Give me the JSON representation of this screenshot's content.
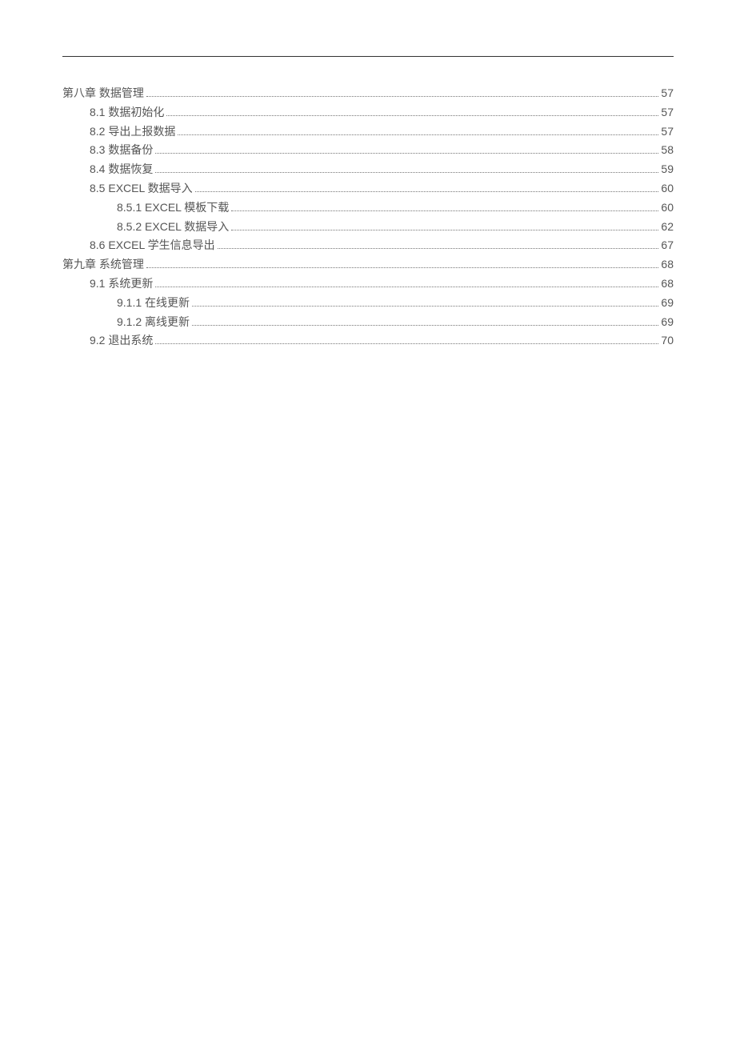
{
  "toc": [
    {
      "label": "第八章  数据管理",
      "page": "57",
      "level": 0
    },
    {
      "label": "8.1 数据初始化",
      "page": "57",
      "level": 1
    },
    {
      "label": "8.2 导出上报数据",
      "page": "57",
      "level": 1
    },
    {
      "label": "8.3 数据备份",
      "page": "58",
      "level": 1
    },
    {
      "label": "8.4 数据恢复",
      "page": "59",
      "level": 1
    },
    {
      "label": "8.5 EXCEL 数据导入",
      "page": "60",
      "level": 1
    },
    {
      "label": "8.5.1 EXCEL 模板下载",
      "page": "60",
      "level": 2
    },
    {
      "label": "8.5.2 EXCEL 数据导入",
      "page": "62",
      "level": 2
    },
    {
      "label": "8.6 EXCEL 学生信息导出",
      "page": "67",
      "level": 1
    },
    {
      "label": "第九章  系统管理",
      "page": "68",
      "level": 0
    },
    {
      "label": "9.1  系统更新",
      "page": "68",
      "level": 1
    },
    {
      "label": "9.1.1 在线更新",
      "page": "69",
      "level": 2
    },
    {
      "label": "9.1.2 离线更新",
      "page": "69",
      "level": 2
    },
    {
      "label": "9.2  退出系统",
      "page": "70",
      "level": 1
    }
  ]
}
